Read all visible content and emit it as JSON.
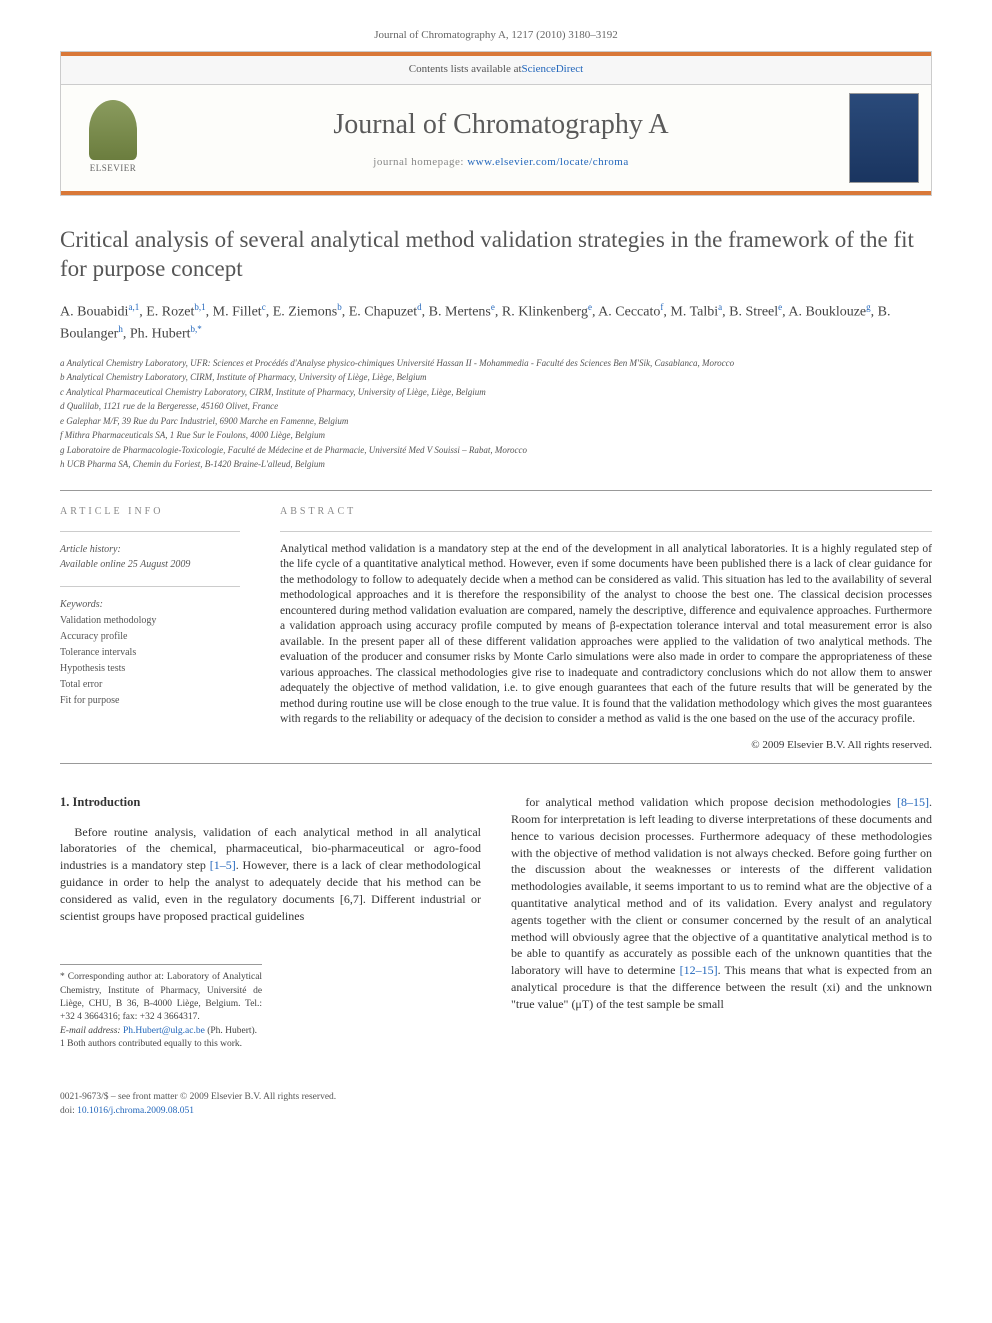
{
  "header_citation": "Journal of Chromatography A, 1217 (2010) 3180–3192",
  "banner": {
    "contents_line_prefix": "Contents lists available at ",
    "contents_link": "ScienceDirect",
    "publisher": "ELSEVIER",
    "journal_name": "Journal of Chromatography A",
    "homepage_prefix": "journal homepage: ",
    "homepage_link": "www.elsevier.com/locate/chroma"
  },
  "article": {
    "title": "Critical analysis of several analytical method validation strategies in the framework of the fit for purpose concept",
    "authors_html": "A. Bouabidi<sup>a,1</sup>, E. Rozet<sup>b,1</sup>, M. Fillet<sup>c</sup>, E. Ziemons<sup>b</sup>, E. Chapuzet<sup>d</sup>, B. Mertens<sup>e</sup>, R. Klinkenberg<sup>e</sup>, A. Ceccato<sup>f</sup>, M. Talbi<sup>a</sup>, B. Streel<sup>e</sup>, A. Bouklouze<sup>g</sup>, B. Boulanger<sup>h</sup>, Ph. Hubert<sup>b,*</sup>",
    "affiliations": [
      "a Analytical Chemistry Laboratory, UFR: Sciences et Procédés d'Analyse physico-chimiques Université Hassan II - Mohammedia - Faculté des Sciences Ben M'Sik, Casablanca, Morocco",
      "b Analytical Chemistry Laboratory, CIRM, Institute of Pharmacy, University of Liège, Liège, Belgium",
      "c Analytical Pharmaceutical Chemistry Laboratory, CIRM, Institute of Pharmacy, University of Liège, Liège, Belgium",
      "d Qualilab, 1121 rue de la Bergeresse, 45160 Olivet, France",
      "e Galephar M/F, 39 Rue du Parc Industriel, 6900 Marche en Famenne, Belgium",
      "f Mithra Pharmaceuticals SA, 1 Rue Sur le Foulons, 4000 Liège, Belgium",
      "g Laboratoire de Pharmacologie-Toxicologie, Faculté de Médecine et de Pharmacie, Université Med V Souissi – Rabat, Morocco",
      "h UCB Pharma SA, Chemin du Foriest, B-1420 Braine-L'alleud, Belgium"
    ]
  },
  "info": {
    "section_label": "ARTICLE INFO",
    "history_label": "Article history:",
    "history_line": "Available online 25 August 2009",
    "keywords_label": "Keywords:",
    "keywords": [
      "Validation methodology",
      "Accuracy profile",
      "Tolerance intervals",
      "Hypothesis tests",
      "Total error",
      "Fit for purpose"
    ]
  },
  "abstract": {
    "section_label": "ABSTRACT",
    "text": "Analytical method validation is a mandatory step at the end of the development in all analytical laboratories. It is a highly regulated step of the life cycle of a quantitative analytical method. However, even if some documents have been published there is a lack of clear guidance for the methodology to follow to adequately decide when a method can be considered as valid. This situation has led to the availability of several methodological approaches and it is therefore the responsibility of the analyst to choose the best one. The classical decision processes encountered during method validation evaluation are compared, namely the descriptive, difference and equivalence approaches. Furthermore a validation approach using accuracy profile computed by means of β-expectation tolerance interval and total measurement error is also available. In the present paper all of these different validation approaches were applied to the validation of two analytical methods. The evaluation of the producer and consumer risks by Monte Carlo simulations were also made in order to compare the appropriateness of these various approaches. The classical methodologies give rise to inadequate and contradictory conclusions which do not allow them to answer adequately the objective of method validation, i.e. to give enough guarantees that each of the future results that will be generated by the method during routine use will be close enough to the true value. It is found that the validation methodology which gives the most guarantees with regards to the reliability or adequacy of the decision to consider a method as valid is the one based on the use of the accuracy profile.",
    "copyright": "© 2009 Elsevier B.V. All rights reserved."
  },
  "body": {
    "section_number": "1.",
    "section_title": "Introduction",
    "col1_text": "Before routine analysis, validation of each analytical method in all analytical laboratories of the chemical, pharmaceutical, bio-pharmaceutical or agro-food industries is a mandatory step [1–5]. However, there is a lack of clear methodological guidance in order to help the analyst to adequately decide that his method can be considered as valid, even in the regulatory documents [6,7]. Different industrial or scientist groups have proposed practical guidelines",
    "col2_text": "for analytical method validation which propose decision methodologies [8–15]. Room for interpretation is left leading to diverse interpretations of these documents and hence to various decision processes. Furthermore adequacy of these methodologies with the objective of method validation is not always checked. Before going further on the discussion about the weaknesses or interests of the different validation methodologies available, it seems important to us to remind what are the objective of a quantitative analytical method and of its validation. Every analyst and regulatory agents together with the client or consumer concerned by the result of an analytical method will obviously agree that the objective of a quantitative analytical method is to be able to quantify as accurately as possible each of the unknown quantities that the laboratory will have to determine [12–15]. This means that what is expected from an analytical procedure is that the difference between the result (xi) and the unknown \"true value\" (μT) of the test sample be small"
  },
  "footnotes": {
    "corresponding": "* Corresponding author at: Laboratory of Analytical Chemistry, Institute of Pharmacy, Université de Liège, CHU, B 36, B-4000 Liège, Belgium. Tel.: +32 4 3664316; fax: +32 4 3664317.",
    "email_label": "E-mail address:",
    "email": "Ph.Hubert@ulg.ac.be",
    "email_suffix": "(Ph. Hubert).",
    "equal": "1 Both authors contributed equally to this work."
  },
  "footer": {
    "line1": "0021-9673/$ – see front matter © 2009 Elsevier B.V. All rights reserved.",
    "doi_prefix": "doi:",
    "doi": "10.1016/j.chroma.2009.08.051"
  }
}
